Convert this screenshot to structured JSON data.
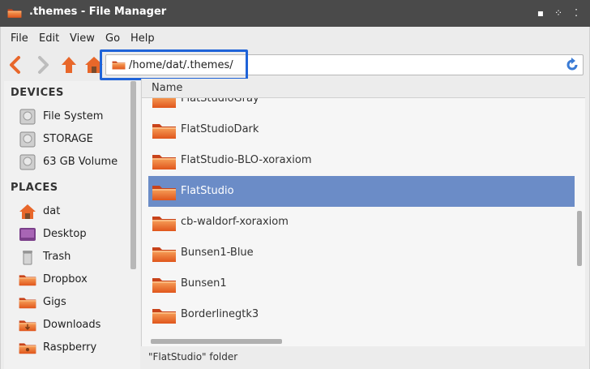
{
  "window": {
    "title": ".themes - File Manager",
    "controls": [
      "minimize",
      "maximize",
      "close"
    ]
  },
  "menu": [
    "File",
    "Edit",
    "View",
    "Go",
    "Help"
  ],
  "toolbar": {
    "back_icon": "back-arrow-icon",
    "forward_icon": "forward-arrow-icon",
    "up_icon": "up-arrow-icon",
    "home_icon": "home-icon"
  },
  "address": {
    "path": "/home/dat/.themes/"
  },
  "sidebar": {
    "devices_heading": "DEVICES",
    "devices": [
      {
        "label": "File System",
        "icon": "drive-icon"
      },
      {
        "label": "STORAGE",
        "icon": "drive-icon"
      },
      {
        "label": "63 GB Volume",
        "icon": "drive-icon"
      }
    ],
    "places_heading": "PLACES",
    "places": [
      {
        "label": "dat",
        "icon": "home-icon"
      },
      {
        "label": "Desktop",
        "icon": "desktop-icon"
      },
      {
        "label": "Trash",
        "icon": "trash-icon"
      },
      {
        "label": "Dropbox",
        "icon": "folder-icon"
      },
      {
        "label": "Gigs",
        "icon": "folder-icon"
      },
      {
        "label": "Downloads",
        "icon": "downloads-folder-icon"
      },
      {
        "label": "Raspberry",
        "icon": "raspberry-folder-icon"
      }
    ]
  },
  "list": {
    "column_name": "Name",
    "items": [
      {
        "name": "FlatStudioGray",
        "selected": false
      },
      {
        "name": "FlatStudioDark",
        "selected": false
      },
      {
        "name": "FlatStudio-BLO-xoraxiom",
        "selected": false
      },
      {
        "name": "FlatStudio",
        "selected": true
      },
      {
        "name": "cb-waldorf-xoraxiom",
        "selected": false
      },
      {
        "name": "Bunsen1-Blue",
        "selected": false
      },
      {
        "name": "Bunsen1",
        "selected": false
      },
      {
        "name": "Borderlinegtk3",
        "selected": false
      }
    ]
  },
  "status": {
    "text": "\"FlatStudio\" folder"
  },
  "colors": {
    "selection": "#6b8cc7",
    "highlight_border": "#1f63d8",
    "folder_orange": "#e8672a"
  }
}
